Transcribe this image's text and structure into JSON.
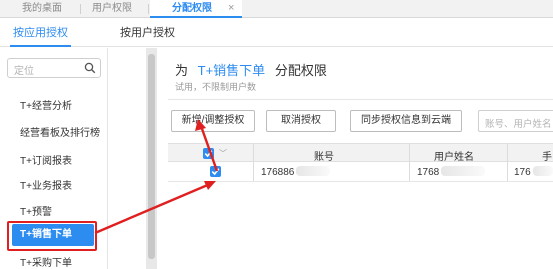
{
  "top_tabs": [
    {
      "label": "我的桌面"
    },
    {
      "label": "用户权限"
    },
    {
      "label": "分配权限",
      "close": "×"
    }
  ],
  "sub_tabs": [
    {
      "label": "按应用授权"
    },
    {
      "label": "按用户授权"
    }
  ],
  "sidebar": {
    "search_placeholder": "定位",
    "items": [
      {
        "label": "T+经营分析"
      },
      {
        "label": "经营看板及排行榜"
      },
      {
        "label": "T+订阅报表"
      },
      {
        "label": "T+业务报表"
      },
      {
        "label": "T+预警"
      },
      {
        "label": "T+销售下单"
      },
      {
        "label": "T+采购下单"
      }
    ]
  },
  "header": {
    "prefix": "为",
    "app_name": "T+销售下单",
    "suffix": "分配权限",
    "hint": "试用，不限制用户数"
  },
  "toolbar": {
    "add_button": "新增/调整授权",
    "cancel_button": "取消授权",
    "sync_button": "同步授权信息到云端",
    "search_placeholder": "账号、用户姓名"
  },
  "table": {
    "columns": [
      "账号",
      "用户姓名",
      "手"
    ],
    "rows": [
      {
        "account": "176886",
        "name": "1768",
        "extra": "176"
      }
    ]
  },
  "colors": {
    "accent": "#2d8cf0",
    "highlight": "#e02020"
  }
}
